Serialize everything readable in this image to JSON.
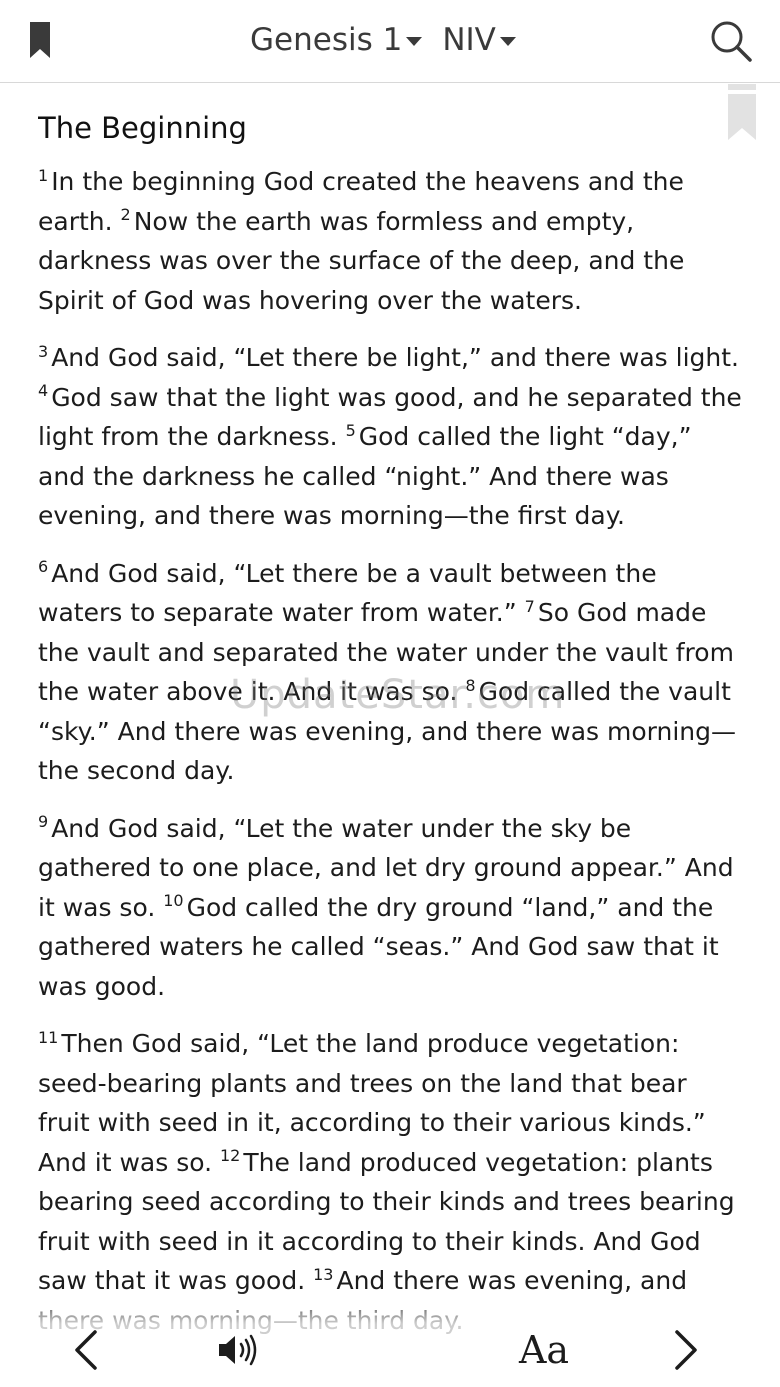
{
  "header": {
    "book": "Genesis 1",
    "version": "NIV"
  },
  "content": {
    "heading": "The Beginning",
    "paragraphs": [
      {
        "verses": [
          {
            "num": "1",
            "text": "In the beginning God created the heavens and the earth. "
          },
          {
            "num": "2",
            "text": "Now the earth was formless and empty, darkness was over the surface of the deep, and the Spirit of God was hovering over the waters."
          }
        ]
      },
      {
        "verses": [
          {
            "num": "3",
            "text": "And God said, “Let there be light,” and there was light. "
          },
          {
            "num": "4",
            "text": "God saw that the light was good, and he separated the light from the darkness. "
          },
          {
            "num": "5",
            "text": "God called the light “day,” and the darkness he called “night.” And there was evening, and there was morning—the first day."
          }
        ]
      },
      {
        "verses": [
          {
            "num": "6",
            "text": "And God said, “Let there be a vault between the waters to separate water from water.” "
          },
          {
            "num": "7",
            "text": "So God made the vault and separated the water under the vault from the water above it. And it was so. "
          },
          {
            "num": "8",
            "text": "God called the vault “sky.” And there was evening, and there was morning—the second day."
          }
        ]
      },
      {
        "verses": [
          {
            "num": "9",
            "text": "And God said, “Let the water under the sky be gathered to one place, and let dry ground appear.” And it was so. "
          },
          {
            "num": "10",
            "text": "God called the dry ground “land,” and the gathered waters he called “seas.” And God saw that it was good."
          }
        ]
      },
      {
        "verses": [
          {
            "num": "11",
            "text": "Then God said, “Let the land produce vegetation: seed-bearing plants and trees on the land that bear fruit with seed in it, according to their various kinds.” And it was so. "
          },
          {
            "num": "12",
            "text": "The land produced vegetation: plants bearing seed according to their kinds and trees bearing fruit with seed in it according to their kinds. And God saw that it was good. "
          },
          {
            "num": "13",
            "text": "And there was evening, and there was morning—the third day."
          }
        ]
      }
    ]
  },
  "watermark": "UpdateStar.com",
  "toolbar": {
    "font_label": "Aa"
  },
  "icons": {
    "bookmark": "bookmark-icon",
    "search": "search-icon",
    "page_bookmark": "page-bookmark-icon",
    "prev": "chevron-left-icon",
    "audio": "speaker-icon",
    "next": "chevron-right-icon"
  },
  "colors": {
    "text": "#1c1c1c",
    "icon": "#3a3a3a",
    "page_bookmark": "#e2e2e2",
    "divider": "#d8d8d8"
  }
}
